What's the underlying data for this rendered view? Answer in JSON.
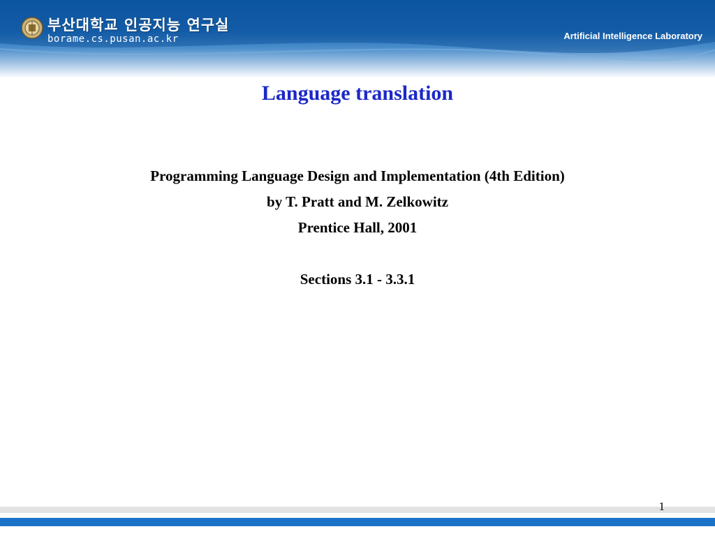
{
  "header": {
    "korean_title": "부산대학교 인공지능 연구실",
    "url": "borame.cs.pusan.ac.kr",
    "lab_name": "Artificial Intelligence Laboratory",
    "logo_icon": "university-seal-icon",
    "colors": {
      "band": "#1a67b3",
      "text": "#ffffff"
    }
  },
  "slide": {
    "title": "Language translation",
    "title_color": "#1c28c8",
    "lines": [
      "Programming Language Design and Implementation (4th Edition)",
      "by T. Pratt and M. Zelkowitz",
      "Prentice Hall, 2001",
      "Sections 3.1 - 3.3.1"
    ]
  },
  "footer": {
    "page_number": "1",
    "bar_color": "#1a73c8"
  }
}
